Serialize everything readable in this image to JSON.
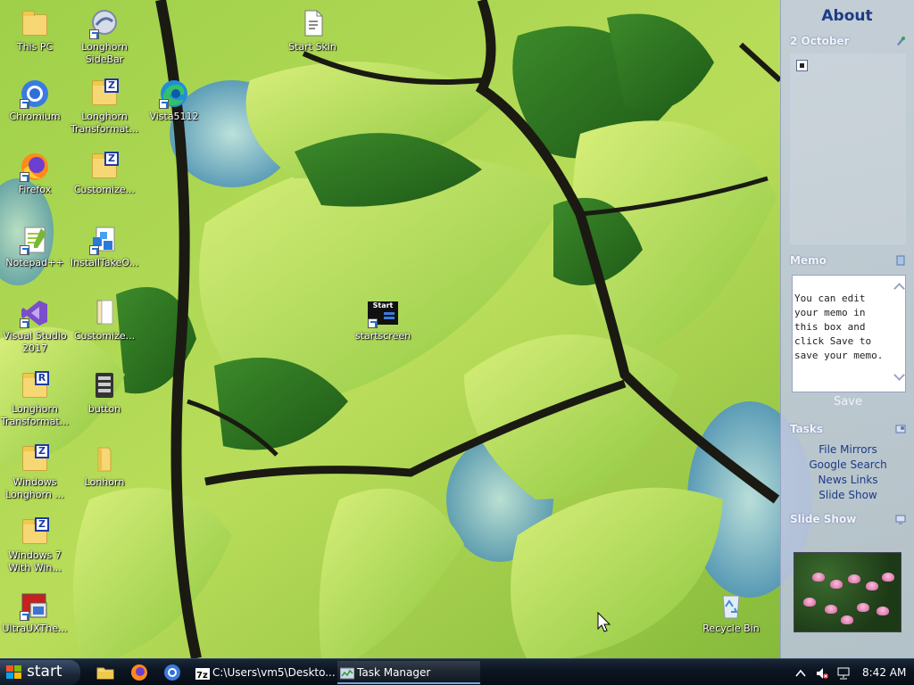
{
  "desktop_icons": [
    {
      "label": "This PC",
      "icon": "folder-icon"
    },
    {
      "label": "Longhorn SideBar",
      "icon": "sidebar-app-icon"
    },
    {
      "label": "Start Skin",
      "icon": "document-icon"
    },
    {
      "label": "Chromium",
      "icon": "chromium-icon"
    },
    {
      "label": "Longhorn Transformat...",
      "icon": "zip-folder-icon"
    },
    {
      "label": "Vista5112",
      "icon": "edge-icon"
    },
    {
      "label": "Firefox",
      "icon": "firefox-icon"
    },
    {
      "label": "Customize...",
      "icon": "zip-folder-icon"
    },
    {
      "label": "Notepad++",
      "icon": "notepad-plus-plus-icon"
    },
    {
      "label": "InstallTakeO...",
      "icon": "installer-icon"
    },
    {
      "label": "Visual Studio 2017",
      "icon": "visual-studio-icon"
    },
    {
      "label": "Customize...",
      "icon": "document-icon"
    },
    {
      "label": "startscreen",
      "icon": "startscreen-shortcut-icon"
    },
    {
      "label": "Longhorn Transformat...",
      "icon": "r-folder-icon"
    },
    {
      "label": "button",
      "icon": "button-app-icon"
    },
    {
      "label": "Windows Longhorn ...",
      "icon": "zip-folder-icon"
    },
    {
      "label": "Lonhorn",
      "icon": "folder-icon"
    },
    {
      "label": "Windows 7 With Win...",
      "icon": "zip-folder-icon"
    },
    {
      "label": "UltraUXThe...",
      "icon": "ultrauxtheme-icon"
    },
    {
      "label": "Recycle Bin",
      "icon": "recycle-bin-icon"
    }
  ],
  "startscreen_badge": "Start",
  "sidebar": {
    "about": "About",
    "calendar": {
      "title": "2 October"
    },
    "memo": {
      "title": "Memo",
      "text": "You can edit your memo in this box and click Save to save your memo.",
      "save_label": "Save"
    },
    "tasks": {
      "title": "Tasks",
      "links": [
        "File Mirrors",
        "Google Search",
        "News Links",
        "Slide Show"
      ]
    },
    "slideshow": {
      "title": "Slide Show"
    }
  },
  "taskbar": {
    "start_label": "start",
    "quick_launch": [
      "file-explorer-icon",
      "firefox-icon",
      "chromium-icon"
    ],
    "tasks": [
      {
        "label": "C:\\Users\\vm5\\Deskto...",
        "icon": "7zip-icon",
        "active": false
      },
      {
        "label": "Task Manager",
        "icon": "task-manager-icon",
        "active": true
      }
    ],
    "clock": "8:42 AM"
  },
  "colors": {
    "sidebar_link": "#1d3b86",
    "taskbar_bg": "#0b1521",
    "leaf_green": "#8cc63f"
  }
}
